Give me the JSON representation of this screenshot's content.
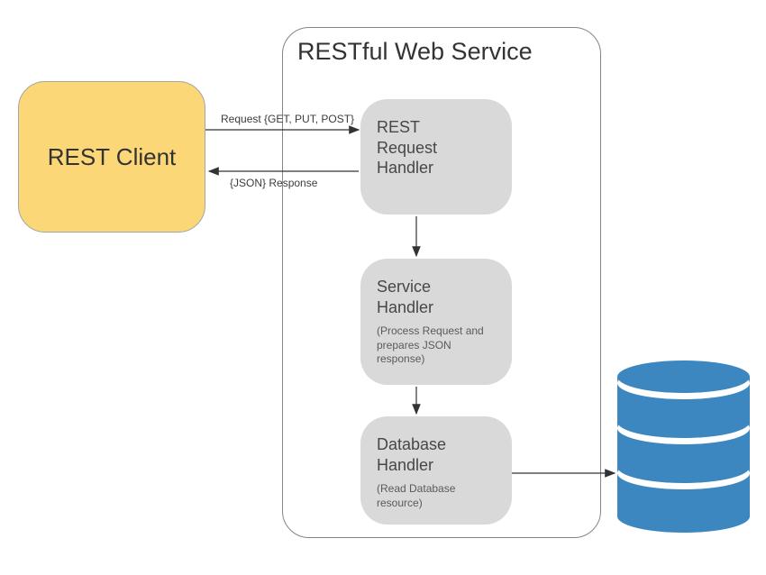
{
  "client": {
    "label": "REST Client"
  },
  "service": {
    "title": "RESTful Web Service",
    "nodes": {
      "request_handler": {
        "title": "REST\nRequest\nHandler"
      },
      "service_handler": {
        "title": "Service\nHandler",
        "sub": "(Process Request and prepares JSON response)"
      },
      "database_handler": {
        "title": "Database\nHandler",
        "sub": "(Read Database resource)"
      }
    }
  },
  "arrows": {
    "request_label": "Request {GET, PUT, POST}",
    "response_label": "{JSON} Response"
  }
}
